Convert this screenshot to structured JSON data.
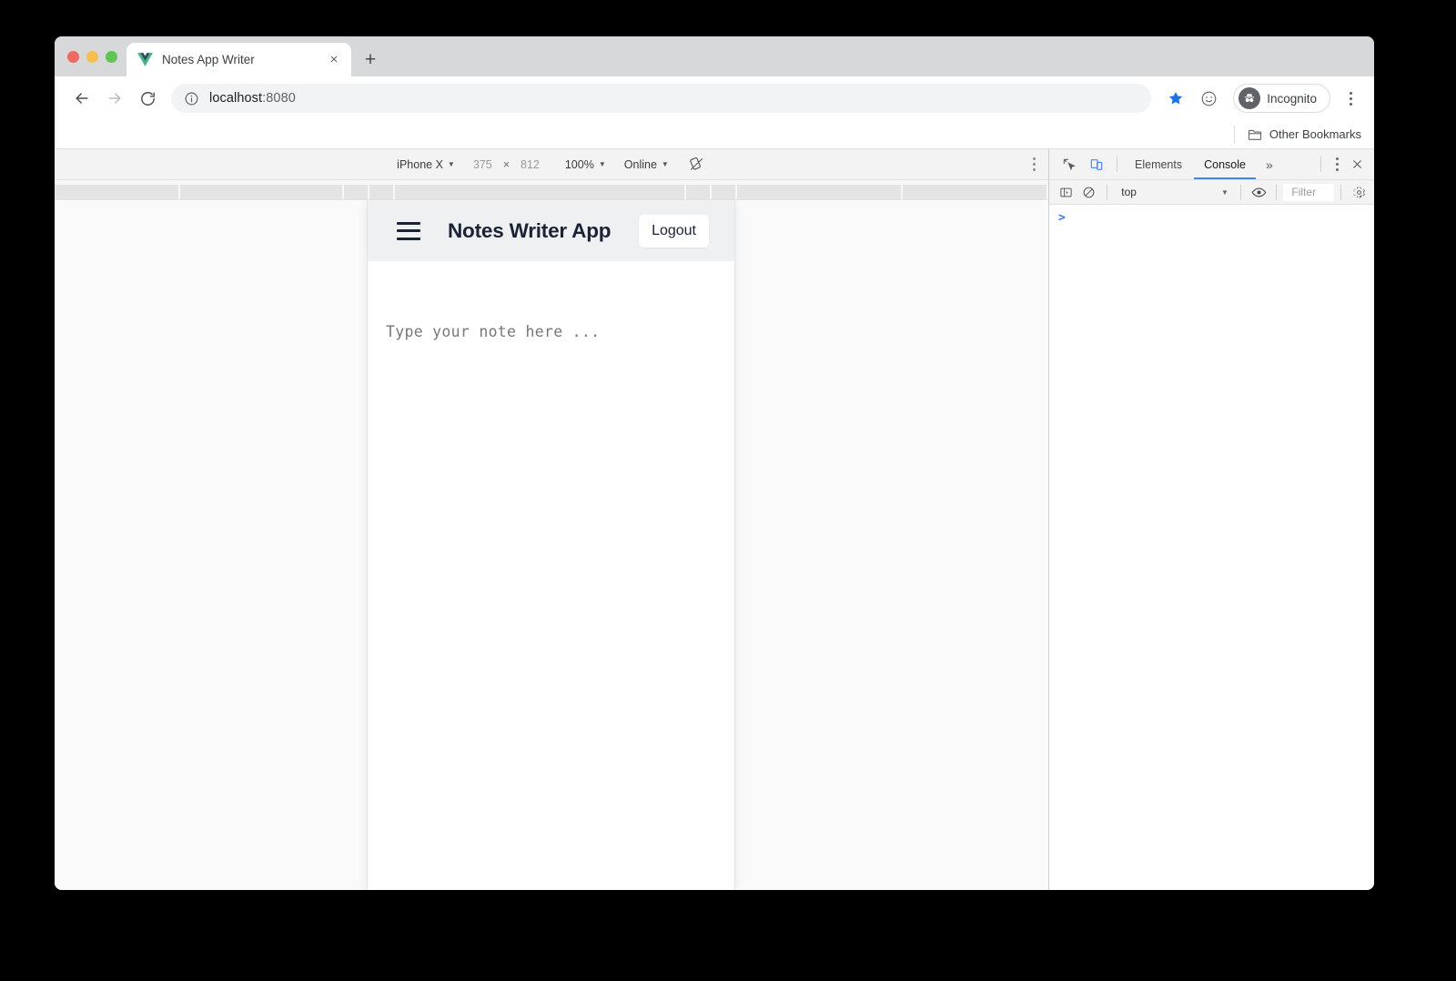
{
  "browser": {
    "tab": {
      "title": "Notes App Writer",
      "favicon": "vue-logo-icon",
      "close_label": "×"
    },
    "new_tab_label": "+",
    "nav": {
      "back_label": "back-arrow",
      "forward_label": "forward-arrow",
      "reload_label": "reload"
    },
    "url": {
      "host": "localhost",
      "port": ":8080",
      "full": "localhost:8080"
    },
    "bookmark_star_active": true,
    "profile_label": "Incognito",
    "bookmarks_bar": {
      "other_bookmarks_label": "Other Bookmarks"
    },
    "accent_color": "#4285f4",
    "star_color": "#1a73e8"
  },
  "device_toolbar": {
    "device": "iPhone X",
    "width": "375",
    "times": "×",
    "height": "812",
    "zoom": "100%",
    "throttling": "Online",
    "rotate_label": "rotate-device",
    "menu_label": "more-options"
  },
  "app": {
    "menu_label": "menu",
    "title": "Notes Writer App",
    "logout_label": "Logout",
    "note": {
      "value": "",
      "placeholder": "Type your note here ..."
    },
    "header_bg": "#eef0f2",
    "title_color": "#1a2236"
  },
  "devtools": {
    "inspect_label": "inspect-element",
    "device_toggle_label": "toggle-device-toolbar",
    "panels": [
      {
        "label": "Elements",
        "active": false
      },
      {
        "label": "Console",
        "active": true
      }
    ],
    "more_panels_label": "»",
    "menu_label": "customize-and-control",
    "close_label": "×",
    "console": {
      "sidebar_toggle_label": "show-console-sidebar",
      "clear_label": "clear-console",
      "context": "top",
      "eye_label": "create-live-expression",
      "filter_placeholder": "Filter",
      "settings_label": "console-settings",
      "prompt": ">",
      "messages": []
    }
  }
}
